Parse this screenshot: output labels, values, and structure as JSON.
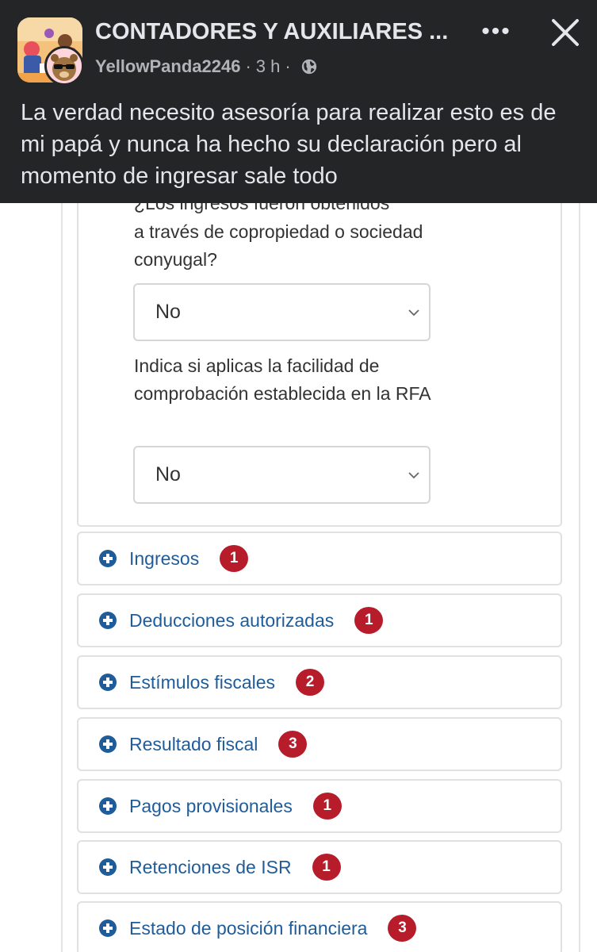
{
  "header": {
    "group_name": "CONTADORES Y AUXILIARES ...",
    "author": "YellowPanda2246",
    "time": "3 h",
    "separator": "·",
    "privacy_icon": "globe-icon",
    "more_label": "•••",
    "close_icon": "close-icon"
  },
  "post": {
    "text": "La verdad necesito asesoría para realizar esto es de mi papá y nunca ha hecho su declaración pero al momento de ingresar sale todo"
  },
  "form": {
    "cut_question": "¿Los ingresos fueron obtenidos",
    "question1": "a través de copropiedad o sociedad conyugal?",
    "select1_value": "No",
    "question2": "Indica si aplicas la facilidad de comprobación establecida en la RFA",
    "select2_value": "No"
  },
  "sections": [
    {
      "label": "Ingresos",
      "count": "1"
    },
    {
      "label": "Deducciones autorizadas",
      "count": "1"
    },
    {
      "label": "Estímulos fiscales",
      "count": "2"
    },
    {
      "label": "Resultado fiscal",
      "count": "3"
    },
    {
      "label": "Pagos provisionales",
      "count": "1"
    },
    {
      "label": "Retenciones de ISR",
      "count": "1"
    },
    {
      "label": "Estado de posición financiera",
      "count": "3"
    }
  ],
  "colors": {
    "fb_background": "#242526",
    "link_blue": "#1f5c99",
    "badge_red": "#b71c2b"
  }
}
